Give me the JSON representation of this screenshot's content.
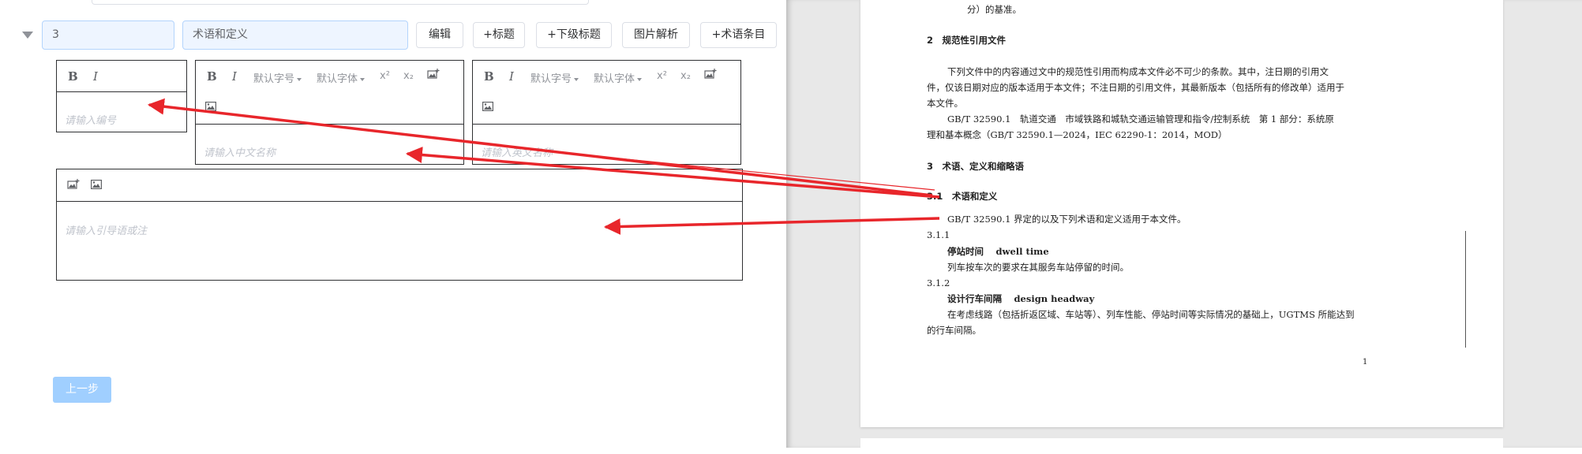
{
  "form": {
    "section_number": "3",
    "section_title": "术语和定义",
    "buttons": {
      "edit": "编辑",
      "add_heading": "+标题",
      "add_subheading": "+下级标题",
      "image_parse": "图片解析",
      "add_term": "+术语条目"
    },
    "toolbar": {
      "bold": "B",
      "italic": "I",
      "font_size": "默认字号",
      "font_family": "默认字体",
      "superscript": "x²",
      "subscript": "x₂"
    },
    "number_field": {
      "placeholder": "请输入编号"
    },
    "chinese_name_field": {
      "placeholder": "请输入中文名称"
    },
    "english_name_field": {
      "placeholder": "请输入英文名称"
    },
    "note_field": {
      "placeholder": "请输入引导语或注"
    },
    "prev_button": "上一步"
  },
  "icons": {
    "collapse": "caret-down-icon",
    "insert_image": "image-insert-icon",
    "image": "image-icon"
  },
  "colors": {
    "input_bg": "#eef5ff",
    "primary_disabled": "#a0cfff",
    "arrow": "#e8262b"
  },
  "document": {
    "lines": [
      {
        "text": "分）的基准。"
      },
      {
        "text": "2　规范性引用文件"
      },
      {
        "text": "下列文件中的内容通过文中的规范性引用而构成本文件必不可少的条款。其中，注日期的引用文"
      },
      {
        "text": "件，仅该日期对应的版本适用于本文件；不注日期的引用文件，其最新版本（包括所有的修改单）适用于"
      },
      {
        "text": "本文件。"
      },
      {
        "text": "GB/T 32590.1　轨道交通　市域铁路和城轨交通运输管理和指令/控制系统　第 1 部分：系统原"
      },
      {
        "text": "理和基本概念（GB/T 32590.1—2024，IEC 62290-1：2014，MOD）"
      },
      {
        "text": "3　术语、定义和缩略语"
      },
      {
        "text": "3.1　术语和定义"
      },
      {
        "text": "GB/T 32590.1 界定的以及下列术语和定义适用于本文件。"
      },
      {
        "text": "3.1.1"
      },
      {
        "text": "停站时间　 dwell time"
      },
      {
        "text": "列车按车次的要求在其服务车站停留的时间。"
      },
      {
        "text": "3.1.2"
      },
      {
        "text": "设计行车间隔　 design headway"
      },
      {
        "text": "在考虑线路（包括折返区域、车站等）、列车性能、停站时间等实际情况的基础上，UGTMS 所能达到"
      },
      {
        "text": "的行车间隔。"
      }
    ],
    "page_number": "1"
  }
}
